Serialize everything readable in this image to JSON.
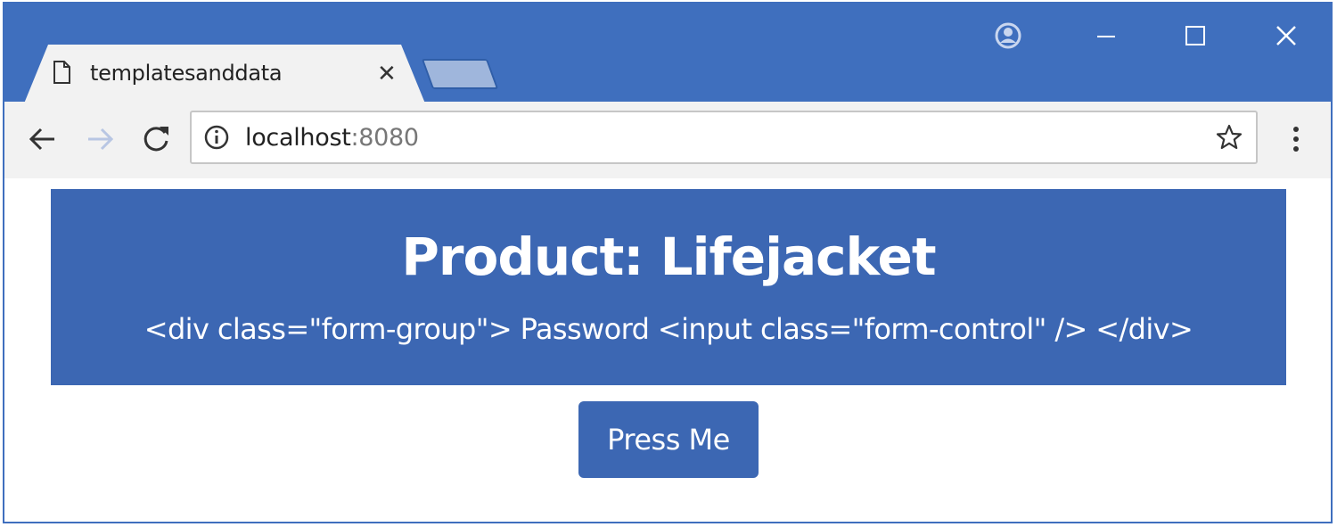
{
  "browser": {
    "tab": {
      "title": "templatesanddata",
      "close_symbol": "✕"
    },
    "address_bar": {
      "host": "localhost",
      "port": ":8080"
    },
    "icons": {
      "page": "page-icon",
      "profile": "profile-icon",
      "minimize": "minimize-icon",
      "maximize": "maximize-icon",
      "close": "close-icon",
      "back": "back-icon",
      "forward": "forward-icon",
      "reload": "reload-icon",
      "info": "info-icon",
      "star": "star-icon",
      "menu": "menu-icon"
    },
    "colors": {
      "frame": "#3f6fbe",
      "toolbar": "#f2f2f2",
      "new_tab": "#9fb6dc"
    }
  },
  "page": {
    "title": "Product: Lifejacket",
    "template_text": "<div class=\"form-group\"> Password <input class=\"form-control\" /> </div>",
    "button_label": "Press Me",
    "colors": {
      "primary": "#3c67b3",
      "text_on_primary": "#ffffff"
    }
  }
}
